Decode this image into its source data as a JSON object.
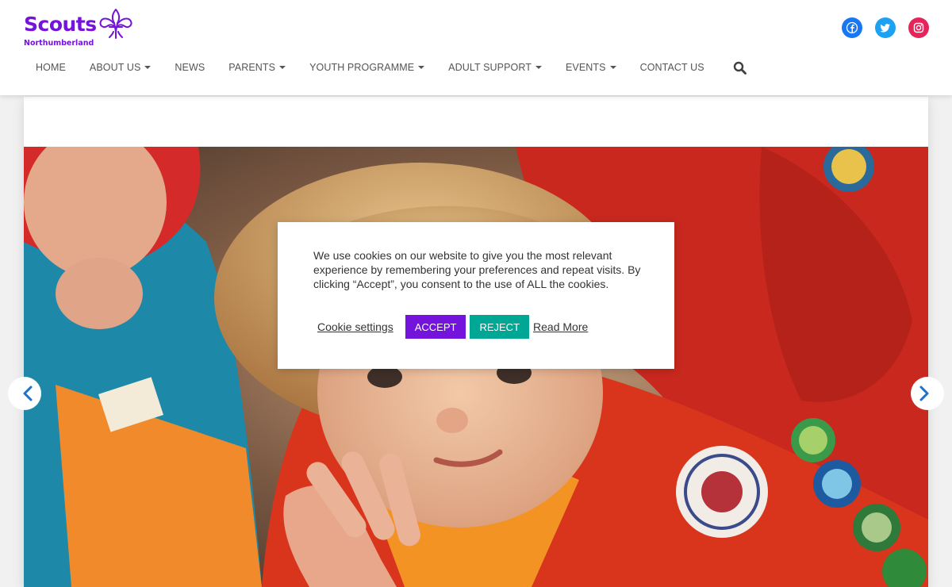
{
  "brand": {
    "name": "Scouts",
    "sub": "Northumberland",
    "color": "#7413dc"
  },
  "social": [
    {
      "name": "facebook-icon",
      "color": "#1877f2"
    },
    {
      "name": "twitter-icon",
      "color": "#1da1f2"
    },
    {
      "name": "instagram-icon",
      "color": "#e4245b"
    }
  ],
  "nav": {
    "items": [
      {
        "label": "HOME",
        "dropdown": false
      },
      {
        "label": "ABOUT US",
        "dropdown": true
      },
      {
        "label": "NEWS",
        "dropdown": false
      },
      {
        "label": "PARENTS",
        "dropdown": true
      },
      {
        "label": "YOUTH PROGRAMME",
        "dropdown": true
      },
      {
        "label": "ADULT SUPPORT",
        "dropdown": true
      },
      {
        "label": "EVENTS",
        "dropdown": true
      },
      {
        "label": "CONTACT US",
        "dropdown": false
      }
    ],
    "search_icon": "search-icon"
  },
  "slider": {
    "prev_icon": "chevron-left-icon",
    "next_icon": "chevron-right-icon"
  },
  "cookie": {
    "text": "We use cookies on our website to give you the most relevant experience by remembering your preferences and repeat visits. By clicking “Accept”, you consent to the use of ALL the cookies.",
    "settings_label": "Cookie settings",
    "accept_label": "ACCEPT",
    "reject_label": "REJECT",
    "read_more_label": "Read More",
    "accept_color": "#7413dc",
    "reject_color": "#00a794"
  }
}
